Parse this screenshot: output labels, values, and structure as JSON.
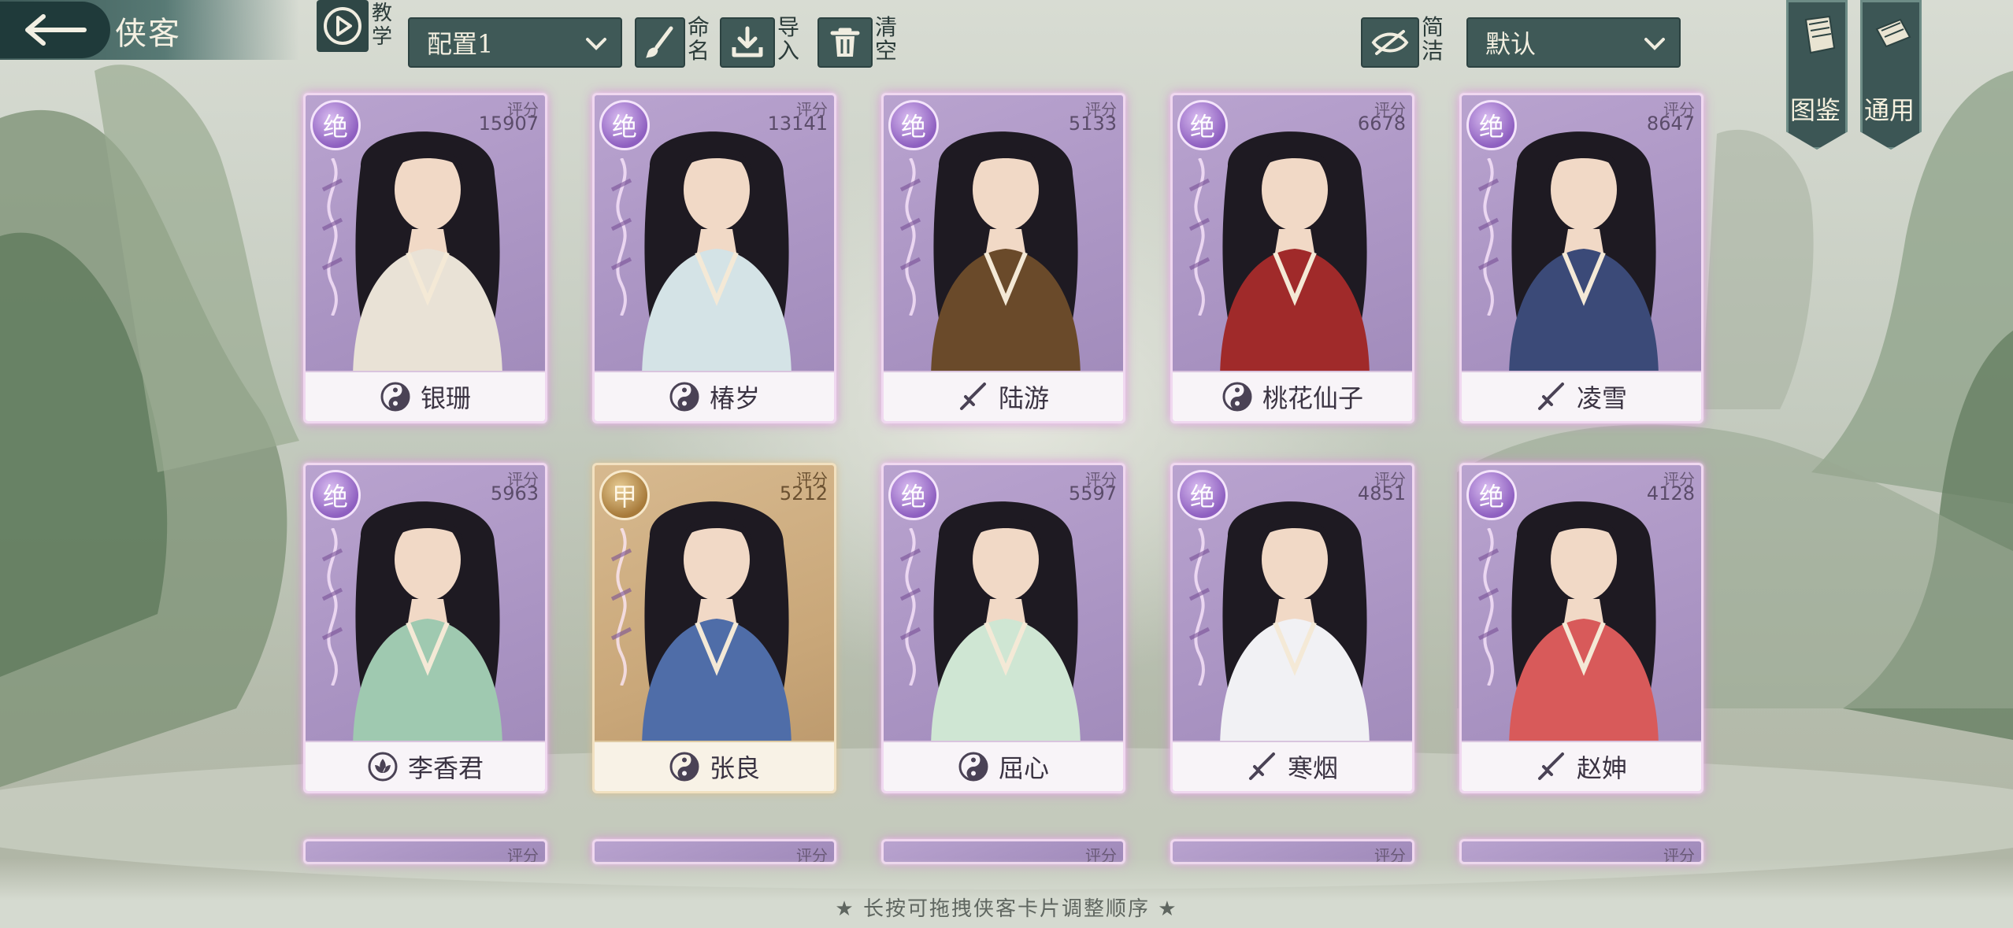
{
  "header": {
    "title": "侠客",
    "tutorial_label": "教学",
    "config_select": "配置1",
    "rename_label": "命名",
    "import_label": "导入",
    "clear_label": "清空",
    "simple_label": "简洁",
    "sort_select": "默认",
    "gallery_label": "图鉴",
    "general_label": "通用"
  },
  "score_label": "评分",
  "cards": [
    {
      "name": "银珊",
      "rank": "绝",
      "score": "15907",
      "tier": "purple",
      "type_icon": "taiji-icon"
    },
    {
      "name": "椿岁",
      "rank": "绝",
      "score": "13141",
      "tier": "purple",
      "type_icon": "taiji-icon"
    },
    {
      "name": "陆游",
      "rank": "绝",
      "score": "5133",
      "tier": "purple",
      "type_icon": "sword-icon"
    },
    {
      "name": "桃花仙子",
      "rank": "绝",
      "score": "6678",
      "tier": "purple",
      "type_icon": "taiji-icon"
    },
    {
      "name": "凌雪",
      "rank": "绝",
      "score": "8647",
      "tier": "purple",
      "type_icon": "sword-icon"
    },
    {
      "name": "李香君",
      "rank": "绝",
      "score": "5963",
      "tier": "purple",
      "type_icon": "lotus-icon"
    },
    {
      "name": "张良",
      "rank": "甲",
      "score": "5212",
      "tier": "gold",
      "type_icon": "taiji-icon"
    },
    {
      "name": "屈心",
      "rank": "绝",
      "score": "5597",
      "tier": "purple",
      "type_icon": "taiji-icon"
    },
    {
      "name": "寒烟",
      "rank": "绝",
      "score": "4851",
      "tier": "purple",
      "type_icon": "sword-icon"
    },
    {
      "name": "赵妽",
      "rank": "绝",
      "score": "4128",
      "tier": "purple",
      "type_icon": "sword-icon"
    }
  ],
  "hint": "★ 长按可拖拽侠客卡片调整顺序 ★",
  "colors": {
    "purple_card": "#a993c2",
    "gold_card": "#c9a779",
    "topbar": "#3f5957",
    "rank_purple": "#8e5fc0"
  }
}
